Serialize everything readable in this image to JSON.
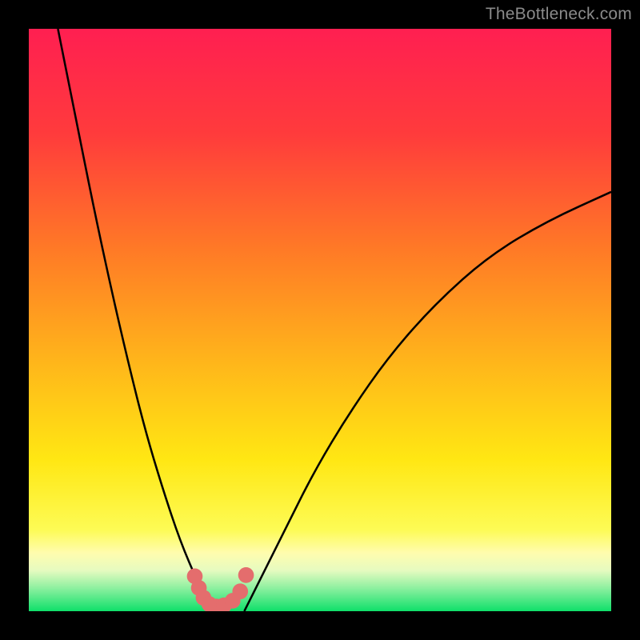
{
  "watermark": "TheBottleneck.com",
  "chart_data": {
    "type": "line",
    "title": "",
    "xlabel": "",
    "ylabel": "",
    "xlim": [
      0,
      100
    ],
    "ylim": [
      0,
      100
    ],
    "series": [
      {
        "name": "left-curve",
        "x": [
          5,
          8,
          11,
          14,
          17,
          20,
          23,
          26,
          29,
          31
        ],
        "y": [
          100,
          85,
          70,
          56,
          43,
          31,
          21,
          12,
          5,
          0
        ]
      },
      {
        "name": "right-curve",
        "x": [
          37,
          40,
          44,
          49,
          55,
          62,
          70,
          79,
          89,
          100
        ],
        "y": [
          0,
          6,
          14,
          24,
          34,
          44,
          53,
          61,
          67,
          72
        ]
      }
    ],
    "valley_markers": {
      "name": "valley-dots",
      "x": [
        28.5,
        29.2,
        30.0,
        31.0,
        32.2,
        33.5,
        35.0,
        36.3,
        37.3
      ],
      "y": [
        6.0,
        4.0,
        2.3,
        1.2,
        0.8,
        1.0,
        1.8,
        3.4,
        6.2
      ]
    },
    "gradient_stops": [
      {
        "pct": 0,
        "color": "#ff1f51"
      },
      {
        "pct": 18,
        "color": "#ff3b3c"
      },
      {
        "pct": 38,
        "color": "#ff7a26"
      },
      {
        "pct": 58,
        "color": "#ffb81a"
      },
      {
        "pct": 74,
        "color": "#ffe713"
      },
      {
        "pct": 86,
        "color": "#fdfb55"
      },
      {
        "pct": 90,
        "color": "#fffcae"
      },
      {
        "pct": 93,
        "color": "#e6fbc0"
      },
      {
        "pct": 96,
        "color": "#8ef0a0"
      },
      {
        "pct": 100,
        "color": "#0fe06a"
      }
    ],
    "marker_color": "#e46d6d",
    "curve_color": "#000000"
  }
}
